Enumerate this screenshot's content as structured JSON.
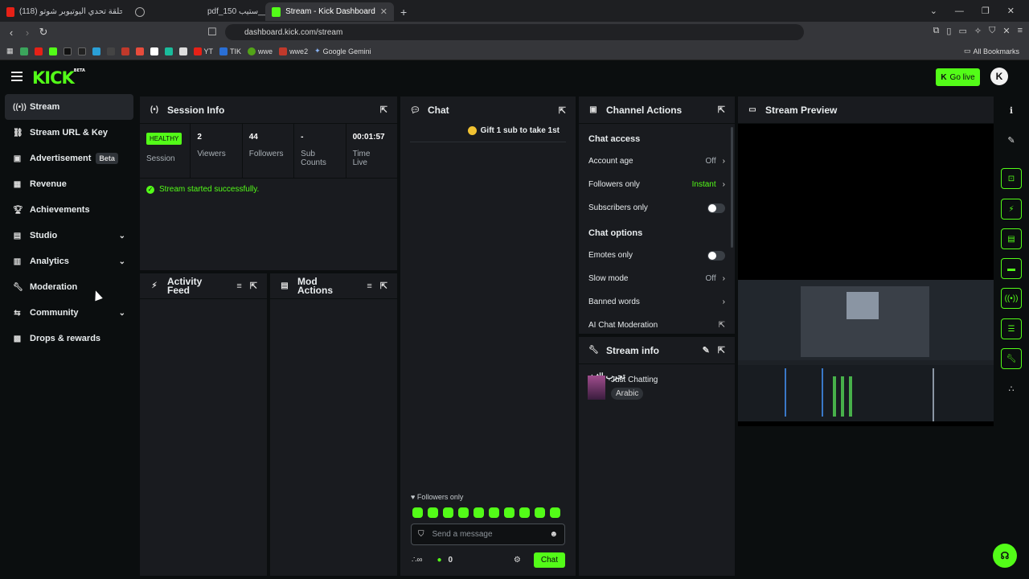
{
  "browser": {
    "tabs": [
      {
        "label": "(118) اقوى حلقة تحدي اليوتيوبر شوتو"
      },
      {
        "label": "pdf_150 ستيب__"
      },
      {
        "label": "Stream - Kick Dashboard"
      }
    ],
    "url": "dashboard.kick.com/stream",
    "bookmarks": [
      "YT",
      "TIK",
      "wwe",
      "wwe2",
      "Google Gemini"
    ],
    "all_bookmarks": "All Bookmarks"
  },
  "header": {
    "logo": "KICK",
    "logo_badge": "BETA",
    "go_live": "Go live",
    "avatar": "K"
  },
  "sidebar": {
    "items": [
      {
        "label": "Stream"
      },
      {
        "label": "Stream URL & Key"
      },
      {
        "label": "Advertisement",
        "badge": "Beta"
      },
      {
        "label": "Revenue"
      },
      {
        "label": "Achievements"
      },
      {
        "label": "Studio"
      },
      {
        "label": "Analytics"
      },
      {
        "label": "Moderation"
      },
      {
        "label": "Community"
      },
      {
        "label": "Drops & rewards"
      }
    ]
  },
  "session_info": {
    "title": "Session Info",
    "health": "HEALTHY",
    "health_label": "Session",
    "stats": [
      {
        "value": "2",
        "label": "Viewers"
      },
      {
        "value": "44",
        "label": "Followers"
      },
      {
        "value": "-",
        "label": "Sub Counts"
      },
      {
        "value": "00:01:57",
        "label": "Time Live"
      }
    ],
    "message": "Stream started successfully."
  },
  "activity_feed": {
    "title": "Activity Feed"
  },
  "mod_actions": {
    "title": "Mod Actions"
  },
  "chat": {
    "title": "Chat",
    "gift_banner": "Gift 1 sub to take 1st",
    "followers_only": "Followers only",
    "placeholder": "Send a message",
    "count": "0",
    "send_label": "Chat"
  },
  "channel_actions": {
    "title": "Channel Actions",
    "chat_access_label": "Chat access",
    "chat_options_label": "Chat options",
    "rows": {
      "account_age": {
        "label": "Account age",
        "value": "Off"
      },
      "followers_only": {
        "label": "Followers only",
        "value": "Instant"
      },
      "subscribers_only": {
        "label": "Subscribers only",
        "enabled": false
      },
      "emotes_only": {
        "label": "Emotes only",
        "enabled": false
      },
      "slow_mode": {
        "label": "Slow mode",
        "value": "Off"
      },
      "banned_words": {
        "label": "Banned words"
      },
      "ai_moderation": {
        "label": "AI Chat Moderation"
      }
    }
  },
  "stream_info": {
    "title": "Stream info",
    "stream_title": "تجرب الثث",
    "category": "Just Chatting",
    "language": "Arabic"
  },
  "stream_preview": {
    "title": "Stream Preview"
  },
  "colors": {
    "accent": "#53fc18",
    "panel": "#191b1f",
    "bg": "#0b0e0f"
  }
}
